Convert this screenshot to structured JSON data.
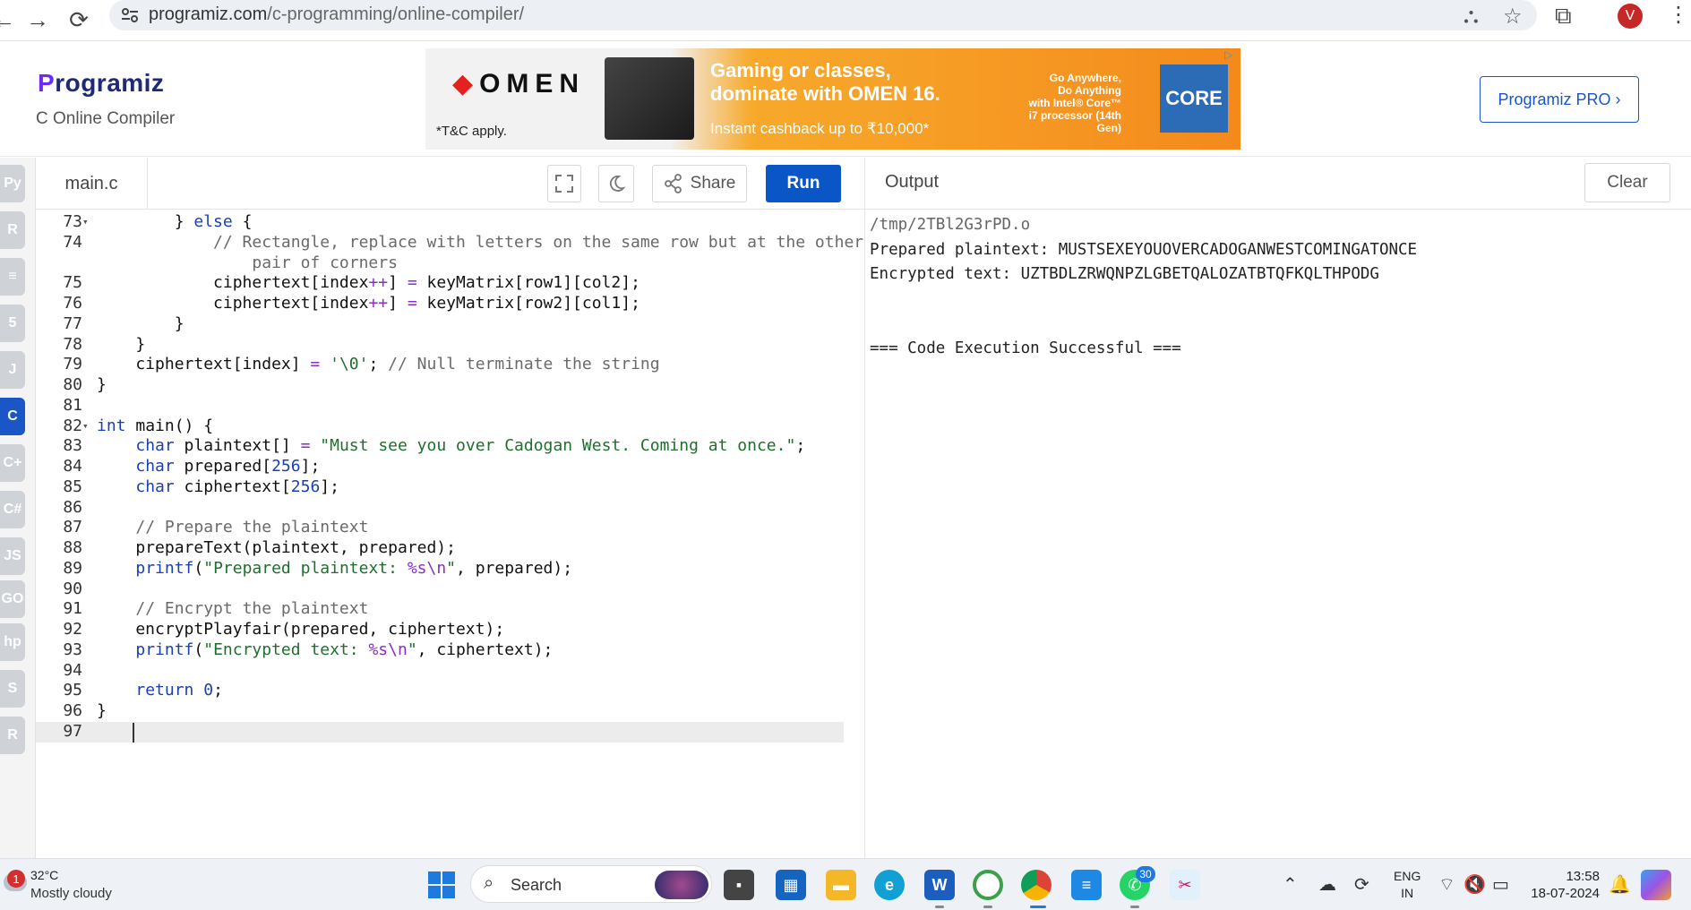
{
  "browser": {
    "url_host": "programiz.com",
    "url_path": "/c-programming/online-compiler/",
    "profile_initial": "V"
  },
  "site": {
    "logo_text": "rogramiz",
    "logo_letter": "P",
    "subtitle": "C Online Compiler",
    "pro_button": "Programiz PRO ›"
  },
  "ad": {
    "brand": "OMEN",
    "headline_1": "Gaming or classes,",
    "headline_2": "dominate with OMEN 16.",
    "cashback": "Instant cashback up to ₹10,000*",
    "tnc": "*T&C apply.",
    "intel_text_1": "Go Anywhere,",
    "intel_text_2": "Do Anything",
    "intel_text_3": "with Intel® Core™",
    "intel_text_4": "i7 processor (14th Gen)",
    "intel_badge": "CORE"
  },
  "language_rail": [
    {
      "name": "python",
      "glyph": "Py"
    },
    {
      "name": "r",
      "glyph": "R"
    },
    {
      "name": "sql",
      "glyph": "≡"
    },
    {
      "name": "html",
      "glyph": "5"
    },
    {
      "name": "java",
      "glyph": "J"
    },
    {
      "name": "c",
      "glyph": "C",
      "active": true
    },
    {
      "name": "cpp",
      "glyph": "C+"
    },
    {
      "name": "csharp",
      "glyph": "C#"
    },
    {
      "name": "javascript",
      "glyph": "JS"
    },
    {
      "name": "go",
      "glyph": "GO"
    },
    {
      "name": "php",
      "glyph": "hp"
    },
    {
      "name": "swift",
      "glyph": "S"
    },
    {
      "name": "rust",
      "glyph": "R"
    }
  ],
  "editor": {
    "file_tab": "main.c",
    "share_label": "Share",
    "run_label": "Run",
    "lines": [
      {
        "n": "73",
        "fold": true,
        "html": "        } <span class=\"kw\">else</span> {"
      },
      {
        "n": "74",
        "fold": false,
        "html": "            <span class=\"cm\">// Rectangle, replace with letters on the same row but at the other</span>"
      },
      {
        "n": "",
        "fold": false,
        "html": "                <span class=\"cm\">pair of corners</span>"
      },
      {
        "n": "75",
        "fold": false,
        "html": "            ciphertext[index<span class=\"op\">++</span>] <span class=\"op\">=</span> keyMatrix[row1][col2];"
      },
      {
        "n": "76",
        "fold": false,
        "html": "            ciphertext[index<span class=\"op\">++</span>] <span class=\"op\">=</span> keyMatrix[row2][col1];"
      },
      {
        "n": "77",
        "fold": false,
        "html": "        }"
      },
      {
        "n": "78",
        "fold": false,
        "html": "    }"
      },
      {
        "n": "79",
        "fold": false,
        "html": "    ciphertext[index] <span class=\"op\">=</span> <span class=\"str\">'\\0'</span>; <span class=\"cm\">// Null terminate the string</span>"
      },
      {
        "n": "80",
        "fold": false,
        "html": "}"
      },
      {
        "n": "81",
        "fold": false,
        "html": ""
      },
      {
        "n": "82",
        "fold": true,
        "html": "<span class=\"kw\">int</span> main() {"
      },
      {
        "n": "83",
        "fold": false,
        "html": "    <span class=\"kw\">char</span> plaintext[] <span class=\"op\">=</span> <span class=\"str\">\"Must see you over Cadogan West. Coming at once.\"</span>;"
      },
      {
        "n": "84",
        "fold": false,
        "html": "    <span class=\"kw\">char</span> prepared[<span class=\"num\">256</span>];"
      },
      {
        "n": "85",
        "fold": false,
        "html": "    <span class=\"kw\">char</span> ciphertext[<span class=\"num\">256</span>];"
      },
      {
        "n": "86",
        "fold": false,
        "html": ""
      },
      {
        "n": "87",
        "fold": false,
        "html": "    <span class=\"cm\">// Prepare the plaintext</span>"
      },
      {
        "n": "88",
        "fold": false,
        "html": "    prepareText(plaintext, prepared);"
      },
      {
        "n": "89",
        "fold": false,
        "html": "    <span class=\"kw\">printf</span>(<span class=\"str\">\"Prepared plaintext: <span class=\"op\">%s\\n</span>\"</span>, prepared);"
      },
      {
        "n": "90",
        "fold": false,
        "html": ""
      },
      {
        "n": "91",
        "fold": false,
        "html": "    <span class=\"cm\">// Encrypt the plaintext</span>"
      },
      {
        "n": "92",
        "fold": false,
        "html": "    encryptPlayfair(prepared, ciphertext);"
      },
      {
        "n": "93",
        "fold": false,
        "html": "    <span class=\"kw\">printf</span>(<span class=\"str\">\"Encrypted text: <span class=\"op\">%s\\n</span>\"</span>, ciphertext);"
      },
      {
        "n": "94",
        "fold": false,
        "html": ""
      },
      {
        "n": "95",
        "fold": false,
        "html": "    <span class=\"kw\">return</span> <span class=\"num\">0</span>;"
      },
      {
        "n": "96",
        "fold": false,
        "html": "}"
      },
      {
        "n": "97",
        "fold": false,
        "html": "",
        "current": true
      }
    ]
  },
  "output": {
    "title": "Output",
    "clear_label": "Clear",
    "path": "/tmp/2TBl2G3rPD.o",
    "line1": "Prepared plaintext: MUSTSEXEYOUOVERCADOGANWESTCOMINGATONCE",
    "line2": "Encrypted text: UZTBDLZRWQNPZLGBETQALOZATBTQFKQLTHPODG",
    "line3": "",
    "line4": "=== Code Execution Successful ==="
  },
  "taskbar": {
    "weather_badge": "1",
    "temperature": "32°C",
    "weather_desc": "Mostly cloudy",
    "search_label": "Search",
    "whatsapp_badge": "30",
    "lang_1": "ENG",
    "lang_2": "IN",
    "time": "13:58",
    "date": "18-07-2024"
  },
  "colors": {
    "accent": "#0b56c6",
    "run_button": "#0b56c6",
    "keyword": "#1a3fb0",
    "string": "#1e6f2d",
    "comment": "#6a6a6a"
  }
}
